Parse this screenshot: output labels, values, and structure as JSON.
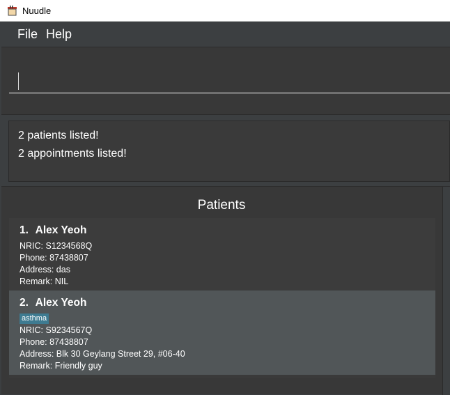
{
  "window": {
    "title": "Nuudle",
    "icon": "nuudle-app-icon"
  },
  "menu": {
    "items": [
      {
        "label": "File"
      },
      {
        "label": "Help"
      }
    ]
  },
  "command_box": {
    "value": "",
    "placeholder": ""
  },
  "result": {
    "lines": [
      "2 patients listed!",
      "2 appointments listed!"
    ]
  },
  "patients": {
    "title": "Patients",
    "items": [
      {
        "index": "1.",
        "name": "Alex Yeoh",
        "tags": [],
        "nric": "NRIC: S1234568Q",
        "phone": "Phone: 87438807",
        "address": "Address: das",
        "remark": "Remark: NIL"
      },
      {
        "index": "2.",
        "name": "Alex Yeoh",
        "tags": [
          "asthma"
        ],
        "nric": "NRIC: S9234567Q",
        "phone": "Phone: 87438807",
        "address": "Address: Blk 30 Geylang Street 29, #06-40",
        "remark": "Remark: Friendly guy"
      }
    ]
  },
  "colors": {
    "background": "#3c3f41",
    "selected_card": "#515658",
    "tag": "#3e7b91"
  }
}
